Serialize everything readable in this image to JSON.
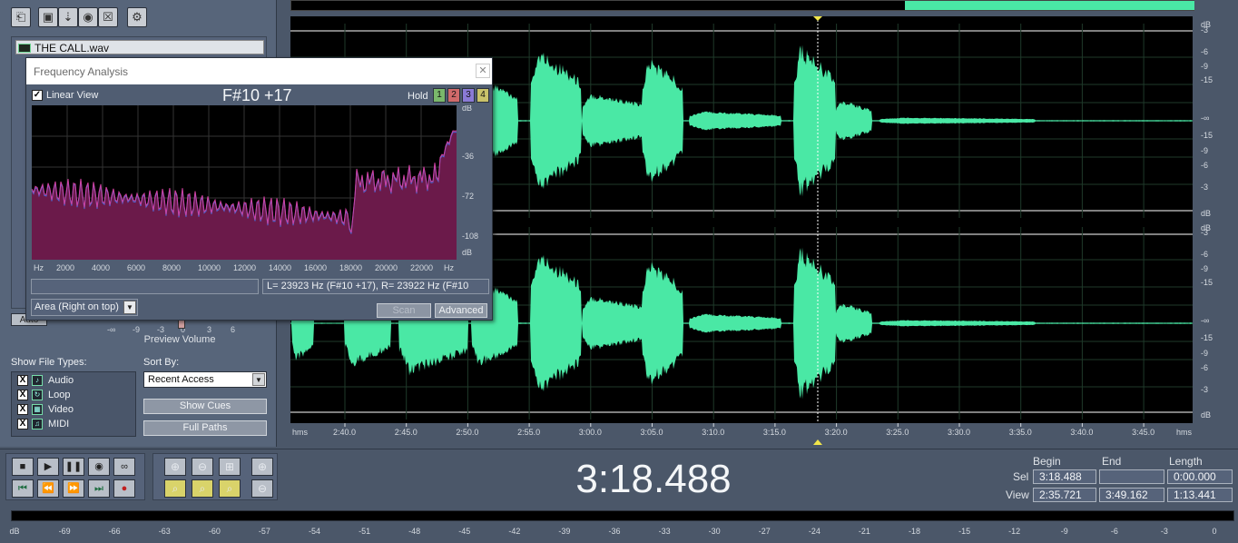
{
  "organizer": {
    "files": [
      "THE CALL.wav"
    ],
    "preview_volume_label": "Preview Volume",
    "volume_ticks": [
      "-∞",
      "-9",
      "-3",
      "0",
      "3",
      "6"
    ],
    "auto_label": "Auto",
    "show_file_types_label": "Show File Types:",
    "file_types": [
      {
        "label": "Audio",
        "checked": "X",
        "icon": "audio-icon"
      },
      {
        "label": "Loop",
        "checked": "X",
        "icon": "loop-icon"
      },
      {
        "label": "Video",
        "checked": "X",
        "icon": "video-icon"
      },
      {
        "label": "MIDI",
        "checked": "X",
        "icon": "midi-icon"
      }
    ],
    "sort_by_label": "Sort By:",
    "sort_value": "Recent Access",
    "show_cues_label": "Show Cues",
    "full_paths_label": "Full Paths"
  },
  "frequency_analysis": {
    "title": "Frequency Analysis",
    "linear_view_label": "Linear View",
    "linear_view_checked": "✓",
    "note": "F#10 +17",
    "hold_label": "Hold",
    "hold_buttons": [
      {
        "label": "1",
        "color": "#7ab86b"
      },
      {
        "label": "2",
        "color": "#d06a6a"
      },
      {
        "label": "3",
        "color": "#8a7ad6"
      },
      {
        "label": "4",
        "color": "#c9c26a"
      }
    ],
    "db_labels": [
      "dB",
      "-36",
      "-72",
      "-108",
      "dB"
    ],
    "freq_ticks": [
      "Hz",
      "2000",
      "4000",
      "6000",
      "8000",
      "10000",
      "12000",
      "14000",
      "16000",
      "18000",
      "20000",
      "22000",
      "Hz"
    ],
    "readout": "L=  23923 Hz (F#10 +17), R=  23922 Hz (F#10",
    "view_mode": "Area (Right on top)",
    "scan_label": "Scan",
    "advanced_label": "Advanced",
    "colors": {
      "fill": "#6b1a4a",
      "line_left": "#d040a0",
      "line_right": "#4a6ad8"
    }
  },
  "waveform": {
    "db_scale": [
      "dB",
      "-3",
      "-6",
      "-9",
      "-15",
      "-∞",
      "-15",
      "-9",
      "-6",
      "-3",
      "dB"
    ],
    "time_unit": "hms",
    "time_ticks": [
      "2:40.0",
      "2:45.0",
      "2:50.0",
      "2:55.0",
      "3:00.0",
      "3:05.0",
      "3:10.0",
      "3:15.0",
      "3:20.0",
      "3:25.0",
      "3:30.0",
      "3:35.0",
      "3:40.0",
      "3:45.0"
    ],
    "colors": {
      "wave": "#4ae8a5",
      "background": "#000000",
      "grid": "#1f3a2a"
    }
  },
  "transport": {
    "current_time": "3:18.488",
    "headers": {
      "begin": "Begin",
      "end": "End",
      "length": "Length"
    },
    "sel_label": "Sel",
    "view_label": "View",
    "sel": {
      "begin": "3:18.488",
      "end": "",
      "length": "0:00.000"
    },
    "view": {
      "begin": "2:35.721",
      "end": "3:49.162",
      "length": "1:13.441"
    }
  },
  "meter": {
    "ticks": [
      "dB",
      "-69",
      "-66",
      "-63",
      "-60",
      "-57",
      "-54",
      "-51",
      "-48",
      "-45",
      "-42",
      "-39",
      "-36",
      "-33",
      "-30",
      "-27",
      "-24",
      "-21",
      "-18",
      "-15",
      "-12",
      "-9",
      "-6",
      "-3",
      "0"
    ]
  }
}
